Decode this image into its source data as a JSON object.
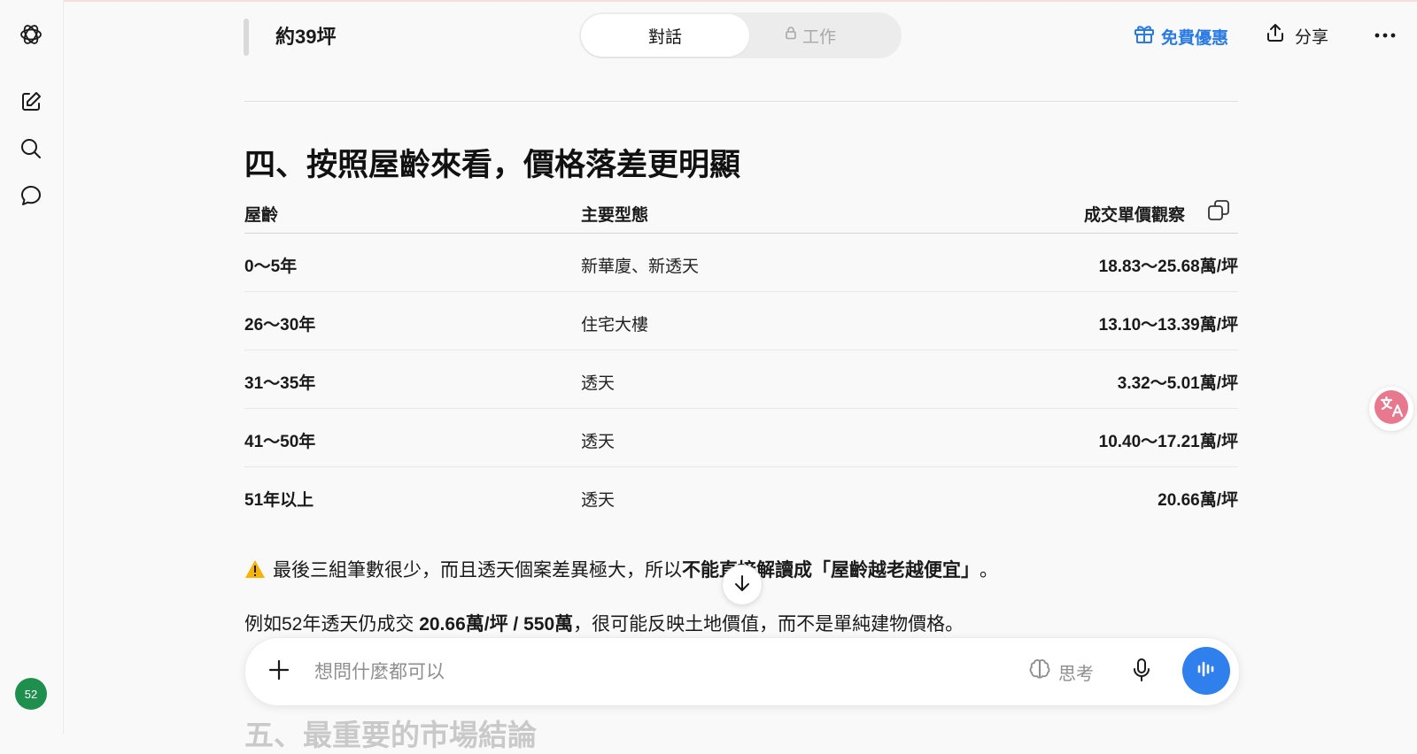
{
  "header": {
    "title": "約39坪",
    "tab_active": "對話",
    "tab_inactive": "工作",
    "promo_label": "免費優惠",
    "share_label": "分享"
  },
  "content": {
    "section_heading": "四、按照屋齡來看，價格落差更明顯",
    "table": {
      "headers": [
        "屋齡",
        "主要型態",
        "成交單價觀察"
      ],
      "rows": [
        [
          "0～5年",
          "新華廈、新透天",
          "18.83～25.68萬/坪"
        ],
        [
          "26～30年",
          "住宅大樓",
          "13.10～13.39萬/坪"
        ],
        [
          "31～35年",
          "透天",
          "3.32～5.01萬/坪"
        ],
        [
          "41～50年",
          "透天",
          "10.40～17.21萬/坪"
        ],
        [
          "51年以上",
          "透天",
          "20.66萬/坪"
        ]
      ]
    },
    "warning": {
      "icon": "⚠️",
      "text_plain": "最後三組筆數很少，而且透天個案差異極大，所以",
      "text_bold": "不能直接解讀成「屋齡越老越便宜」",
      "text_end": "。"
    },
    "example": {
      "pre": "例如52年透天仍成交 ",
      "bold": "20.66萬/坪 / 550萬",
      "post": "，很可能反映土地價值，而不是單純建物價格。"
    },
    "next_heading": "五、最重要的市場結論"
  },
  "composer": {
    "placeholder": "想問什麼都可以",
    "think_label": "思考"
  },
  "sidebar": {
    "avatar_text": "52"
  },
  "colors": {
    "accent": "#2a7ae4",
    "voice_button": "#2f80ed",
    "avatar": "#1f8f4e",
    "translate_icon": "#e8788d"
  }
}
